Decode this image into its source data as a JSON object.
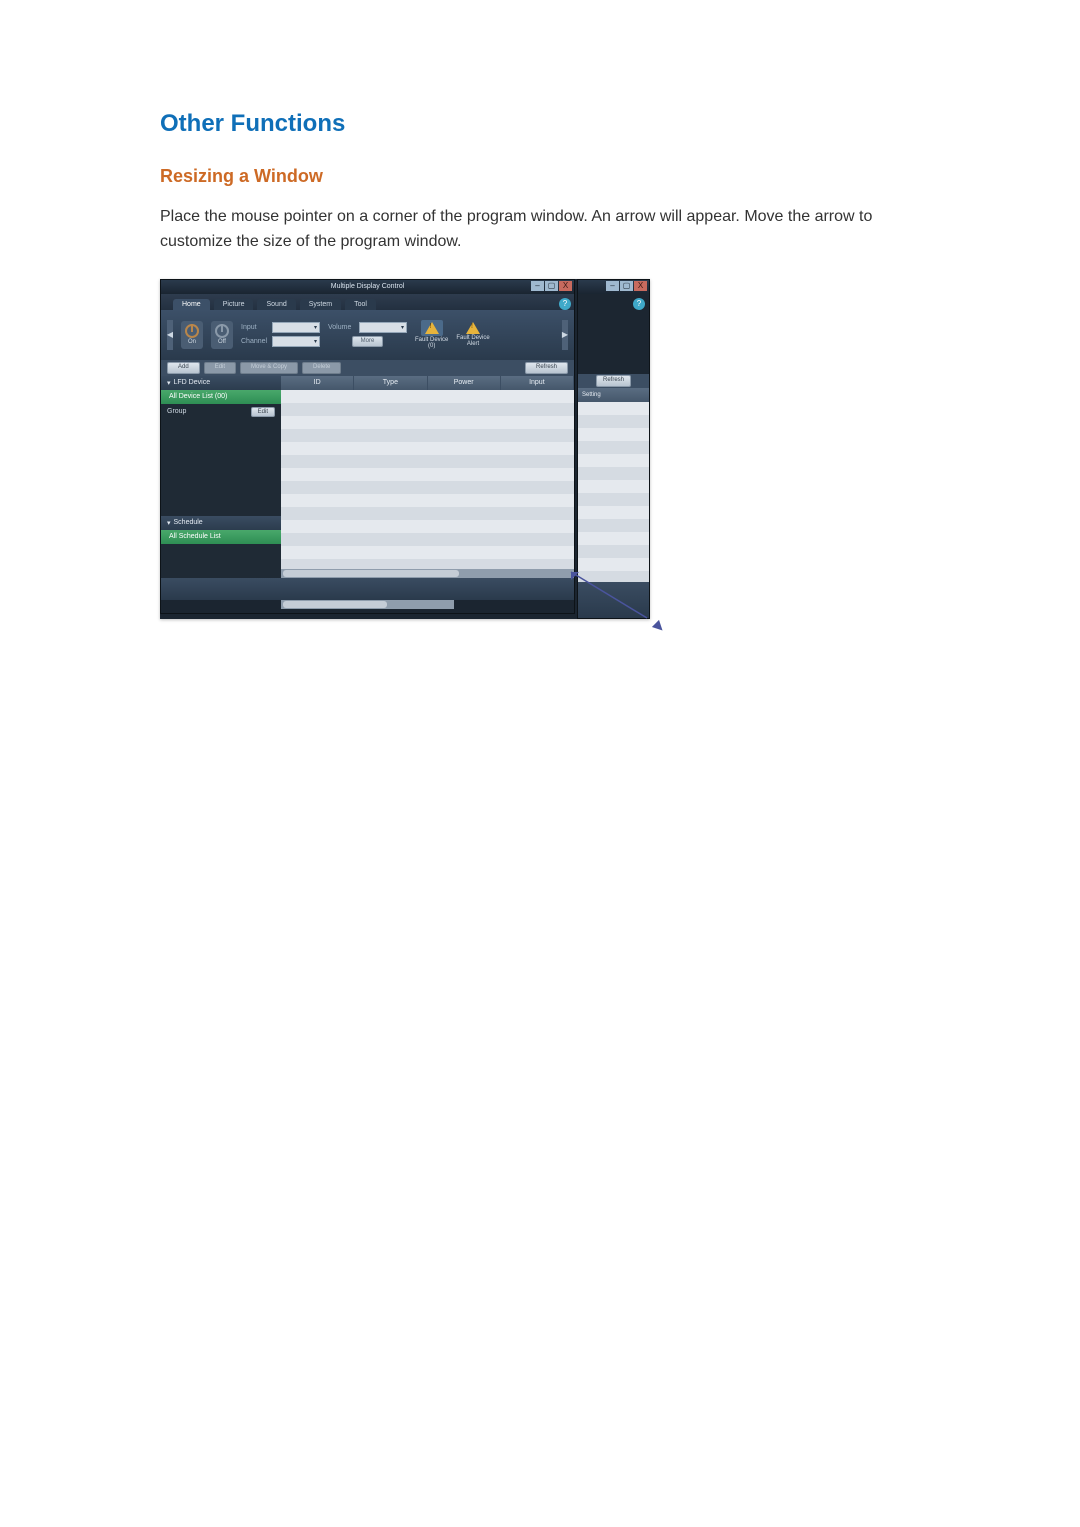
{
  "doc": {
    "heading1": "Other Functions",
    "heading2": "Resizing a Window",
    "body": "Place the mouse pointer on a corner of the program window. An arrow will appear. Move the arrow to customize the size of the program window."
  },
  "app": {
    "title": "Multiple Display Control",
    "win_min": "–",
    "win_max": "▢",
    "win_close": "X",
    "help": "?",
    "tabs": {
      "home": "Home",
      "picture": "Picture",
      "sound": "Sound",
      "system": "System",
      "tool": "Tool"
    },
    "ribbon": {
      "nav_left": "◀",
      "nav_right": "▶",
      "on_label": "On",
      "off_label": "Off",
      "input_label": "Input",
      "channel_label": "Channel",
      "volume_label": "Volume",
      "more_btn": "More",
      "fault_device_count": "Fault Device\n(0)",
      "fault_device_alert": "Fault Device\nAlert"
    },
    "actions": {
      "add": "Add",
      "edit": "Edit",
      "move_copy": "Move & Copy",
      "delete": "Delete",
      "refresh": "Refresh"
    },
    "accordion": {
      "lfd_device": "LFD Device",
      "all_device_list": "All Device List (00)",
      "group_label": "Group",
      "group_edit": "Edit",
      "schedule": "Schedule",
      "all_schedule_list": "All Schedule List"
    },
    "columns": {
      "id": "ID",
      "type": "Type",
      "power": "Power",
      "input_col": "Input",
      "setting": "Setting"
    },
    "select_caret": "▾",
    "acc_caret": "▾"
  }
}
